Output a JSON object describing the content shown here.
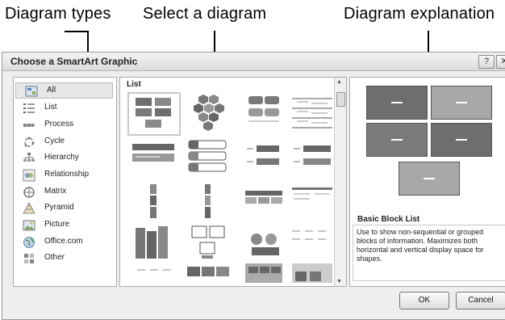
{
  "callouts": {
    "types": "Diagram types",
    "select": "Select a diagram",
    "explanation": "Diagram explanation"
  },
  "dialog": {
    "title": "Choose a SmartArt Graphic",
    "help_label": "?",
    "close_label": "✕"
  },
  "categories": [
    {
      "label": "All",
      "icon": "all-icon",
      "selected": true
    },
    {
      "label": "List",
      "icon": "list-icon"
    },
    {
      "label": "Process",
      "icon": "process-icon"
    },
    {
      "label": "Cycle",
      "icon": "cycle-icon"
    },
    {
      "label": "Hierarchy",
      "icon": "hierarchy-icon"
    },
    {
      "label": "Relationship",
      "icon": "relationship-icon"
    },
    {
      "label": "Matrix",
      "icon": "matrix-icon"
    },
    {
      "label": "Pyramid",
      "icon": "pyramid-icon"
    },
    {
      "label": "Picture",
      "icon": "picture-icon"
    },
    {
      "label": "Office.com",
      "icon": "globe-icon"
    },
    {
      "label": "Other",
      "icon": "other-icon"
    }
  ],
  "gallery": {
    "heading": "List"
  },
  "preview": {
    "name": "Basic Block List",
    "description": "Use to show non-sequential or grouped blocks of information. Maximizes both horizontal and vertical display space for shapes."
  },
  "buttons": {
    "ok": "OK",
    "cancel": "Cancel"
  },
  "colors": {
    "block_dark": "#6e6e6e",
    "block_light": "#a8a8a8"
  }
}
